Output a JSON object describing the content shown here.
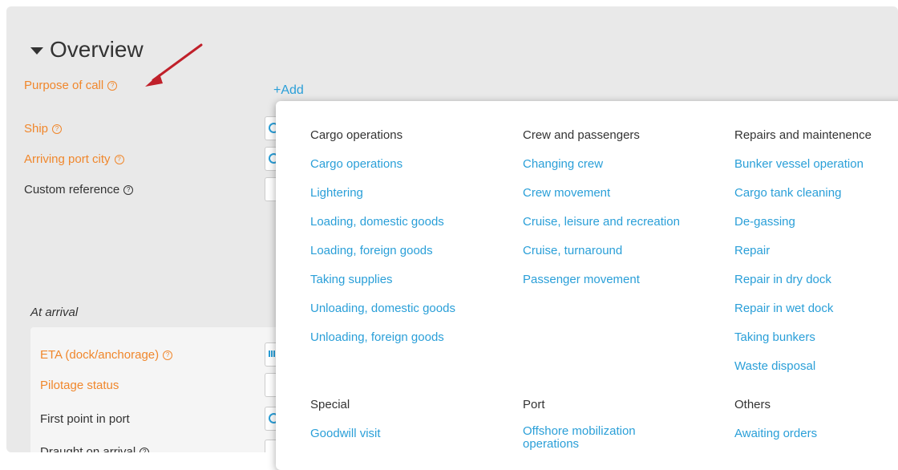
{
  "overview": {
    "title": "Overview",
    "add_label": "+Add"
  },
  "fields": {
    "purpose_of_call": "Purpose of call",
    "ship": "Ship",
    "arriving_port_city": "Arriving port city",
    "custom_reference": "Custom reference"
  },
  "arrival": {
    "heading": "At arrival",
    "eta": "ETA (dock/anchorage)",
    "pilotage_status": "Pilotage status",
    "first_point_in_port": "First point in port",
    "draught_on_arrival": "Draught on arrival"
  },
  "help_icon_glyph": "?",
  "dropdown": {
    "groups": [
      {
        "title": "Cargo operations",
        "items": [
          "Cargo operations",
          "Lightering",
          "Loading, domestic goods",
          "Loading, foreign goods",
          "Taking supplies",
          "Unloading, domestic goods",
          "Unloading, foreign goods"
        ]
      },
      {
        "title": "Crew and passengers",
        "items": [
          "Changing crew",
          "Crew movement",
          "Cruise, leisure and recreation",
          "Cruise, turnaround",
          "Passenger movement"
        ]
      },
      {
        "title": "Repairs and maintenence",
        "items": [
          "Bunker vessel operation",
          "Cargo tank cleaning",
          "De-gassing",
          "Repair",
          "Repair in dry dock",
          "Repair in wet dock",
          "Taking bunkers",
          "Waste disposal"
        ]
      },
      {
        "title": "Special",
        "items": [
          "Goodwill visit"
        ]
      },
      {
        "title": "Port",
        "items": [
          "Offshore mobilization operations"
        ]
      },
      {
        "title": "Others",
        "items": [
          "Awaiting orders"
        ]
      }
    ]
  },
  "colors": {
    "label_orange": "#f0872c",
    "link_blue": "#2a9fd8",
    "arrow_red": "#c0202a",
    "panel_gray": "#e9e9e9"
  }
}
